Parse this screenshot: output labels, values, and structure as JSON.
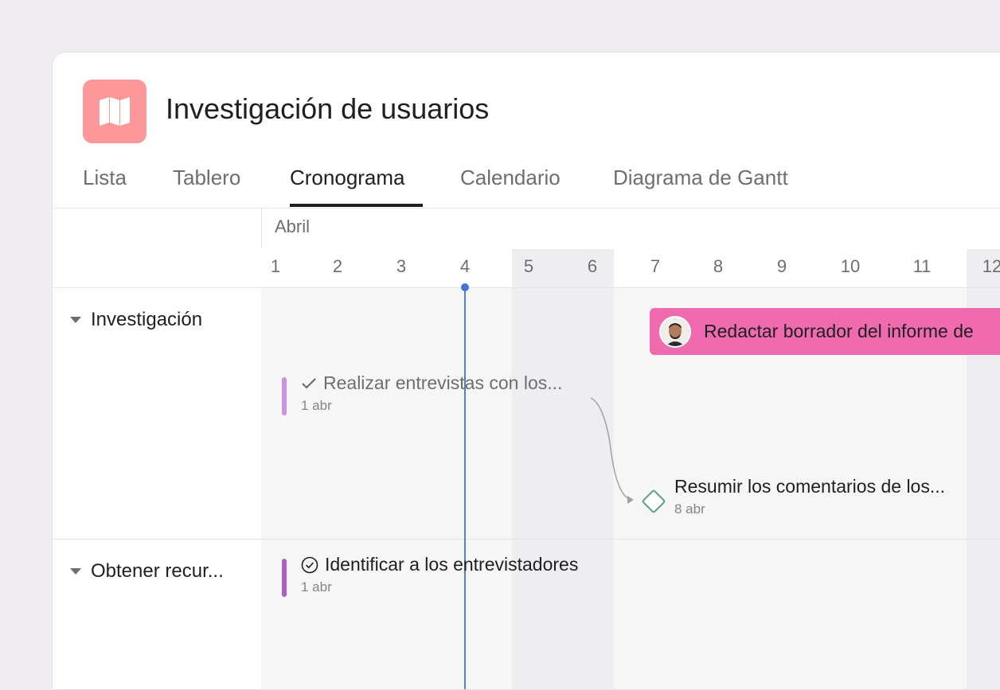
{
  "project": {
    "title": "Investigación de usuarios",
    "icon": "map-icon",
    "icon_color": "#fc979a"
  },
  "tabs": [
    {
      "label": "Lista",
      "active": false
    },
    {
      "label": "Tablero",
      "active": false
    },
    {
      "label": "Cronograma",
      "active": true
    },
    {
      "label": "Calendario",
      "active": false
    },
    {
      "label": "Diagrama de Gantt",
      "active": false
    }
  ],
  "timeline": {
    "month": "Abril",
    "days": [
      "1",
      "2",
      "3",
      "4",
      "5",
      "6",
      "7",
      "8",
      "9",
      "10",
      "11",
      "12"
    ],
    "today_day": "4"
  },
  "sections": [
    {
      "label": "Investigación"
    },
    {
      "label": "Obtener recur..."
    }
  ],
  "tasks": {
    "draft_report": {
      "title": "Redactar borrador del informe de",
      "color": "#f06aaf"
    },
    "interviews": {
      "title": "Realizar entrevistas con los...",
      "date": "1 abr",
      "status": "completed",
      "color": "#c993dd"
    },
    "summarize": {
      "title": "Resumir los comentarios de los...",
      "date": "8 abr",
      "type": "milestone",
      "color": "#58a182"
    },
    "identify": {
      "title": "Identificar a los entrevistadores",
      "date": "1 abr",
      "color": "#a960c8"
    }
  },
  "colors": {
    "accent_today": "#4573d2",
    "text_primary": "#1e1f21",
    "text_secondary": "#6d6e6f"
  }
}
